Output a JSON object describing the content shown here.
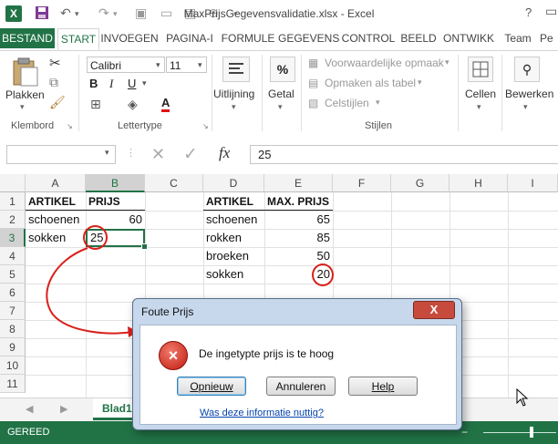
{
  "window": {
    "title": "MaxPrijsGegevensvalidatie.xlsx - Excel",
    "help_label": "?"
  },
  "ribbon": {
    "tabs": [
      "BESTAND",
      "START",
      "INVOEGEN",
      "PAGINA-I",
      "FORMULE",
      "GEGEVENS",
      "CONTROL",
      "BEELD",
      "ONTWIKK",
      "Team",
      "Pe"
    ],
    "active_tab": "START",
    "clipboard": {
      "paste_label": "Plakken",
      "group_label": "Klembord"
    },
    "font": {
      "family": "Calibri",
      "size": "11",
      "group_label": "Lettertype",
      "bold": "B",
      "italic": "I",
      "underline": "U",
      "font_color": "A"
    },
    "alignment": {
      "label": "Uitlijning"
    },
    "number": {
      "label": "Getal",
      "symbol": "%"
    },
    "styles": {
      "conditional": "Voorwaardelijke opmaak",
      "as_table": "Opmaken als tabel",
      "cell_styles": "Celstijlen",
      "group_label": "Stijlen"
    },
    "cells": {
      "label": "Cellen"
    },
    "editing": {
      "label": "Bewerken"
    }
  },
  "formula_bar": {
    "value": "25",
    "fx": "fx"
  },
  "grid": {
    "columns": [
      "A",
      "B",
      "C",
      "D",
      "E",
      "F",
      "G",
      "H",
      "I"
    ],
    "selected_column": "B",
    "rows": [
      "1",
      "2",
      "3",
      "4",
      "5",
      "6",
      "7",
      "8",
      "9",
      "10",
      "11"
    ],
    "selected_row": "3",
    "cells": {
      "A1": "ARTIKEL",
      "B1": "PRIJS",
      "A2": "schoenen",
      "B2": "60",
      "A3": "sokken",
      "B3": "25",
      "D1": "ARTIKEL",
      "E1": "MAX. PRIJS",
      "D2": "schoenen",
      "E2": "65",
      "D3": "rokken",
      "E3": "85",
      "D4": "broeken",
      "E4": "50",
      "D5": "sokken",
      "E5": "20"
    }
  },
  "sheet_tab": "Blad1",
  "status": {
    "mode": "GEREED"
  },
  "dialog": {
    "title": "Foute Prijs",
    "message": "De ingetypte prijs is te hoog",
    "buttons": [
      "Opnieuw",
      "Annuleren",
      "Help"
    ],
    "link": "Was deze informatie nuttig?",
    "close": "X",
    "icon_glyph": "×"
  },
  "colors": {
    "accent": "#217346",
    "annotation": "#d9201a"
  }
}
